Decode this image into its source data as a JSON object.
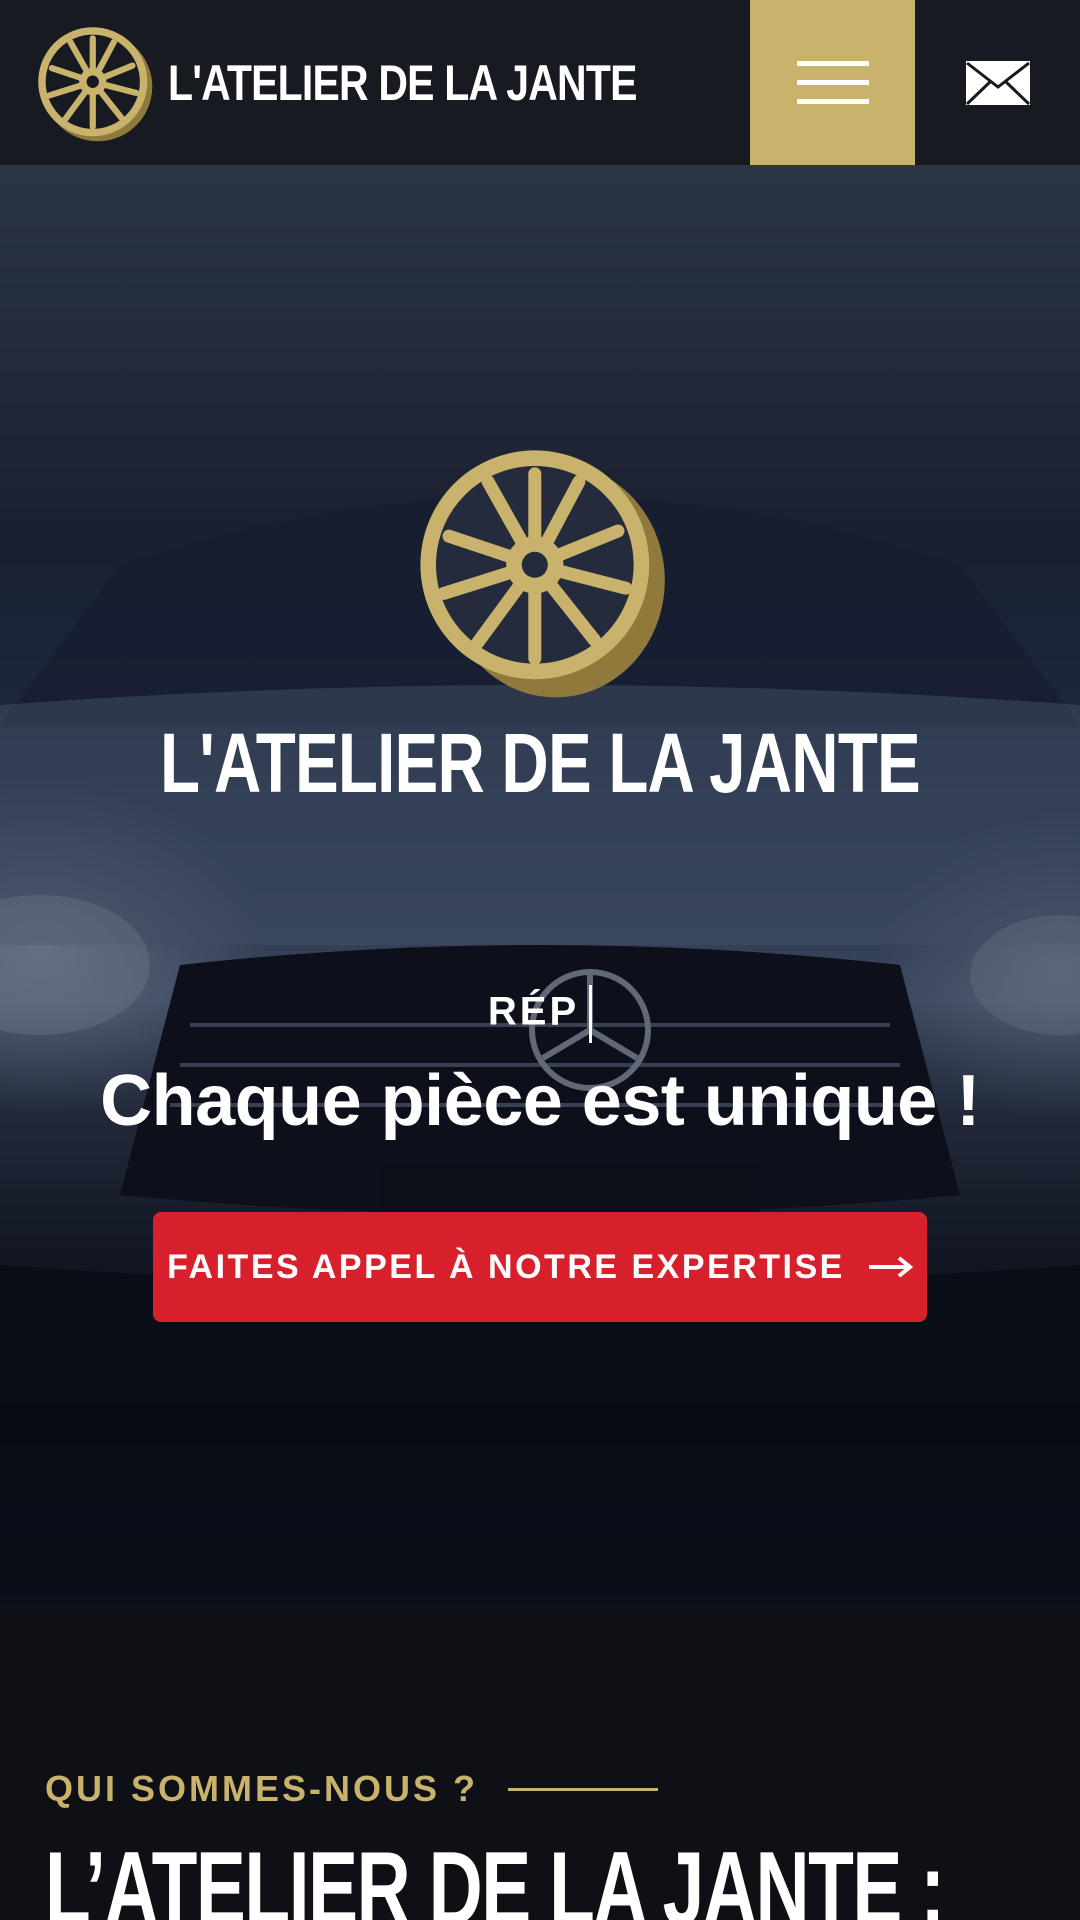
{
  "header": {
    "brand_name": "L'ATELIER DE LA JANTE",
    "menu_icon": "hamburger-icon",
    "mail_icon": "envelope-icon"
  },
  "hero": {
    "title": "L'ATELIER DE LA JANTE",
    "typing_text": "RÉP",
    "tagline": "Chaque pièce est unique !",
    "cta_label": "FAITES APPEL À NOTRE EXPERTISE",
    "cta_icon": "arrow-right-icon"
  },
  "about": {
    "eyebrow": "QUI SOMMES-NOUS ?",
    "title": "L’ATELIER DE LA JANTE :"
  },
  "colors": {
    "gold": "#c9b26b",
    "header_bg": "#181a22",
    "cta_red": "#d7202c",
    "page_bg": "#0f1015"
  }
}
